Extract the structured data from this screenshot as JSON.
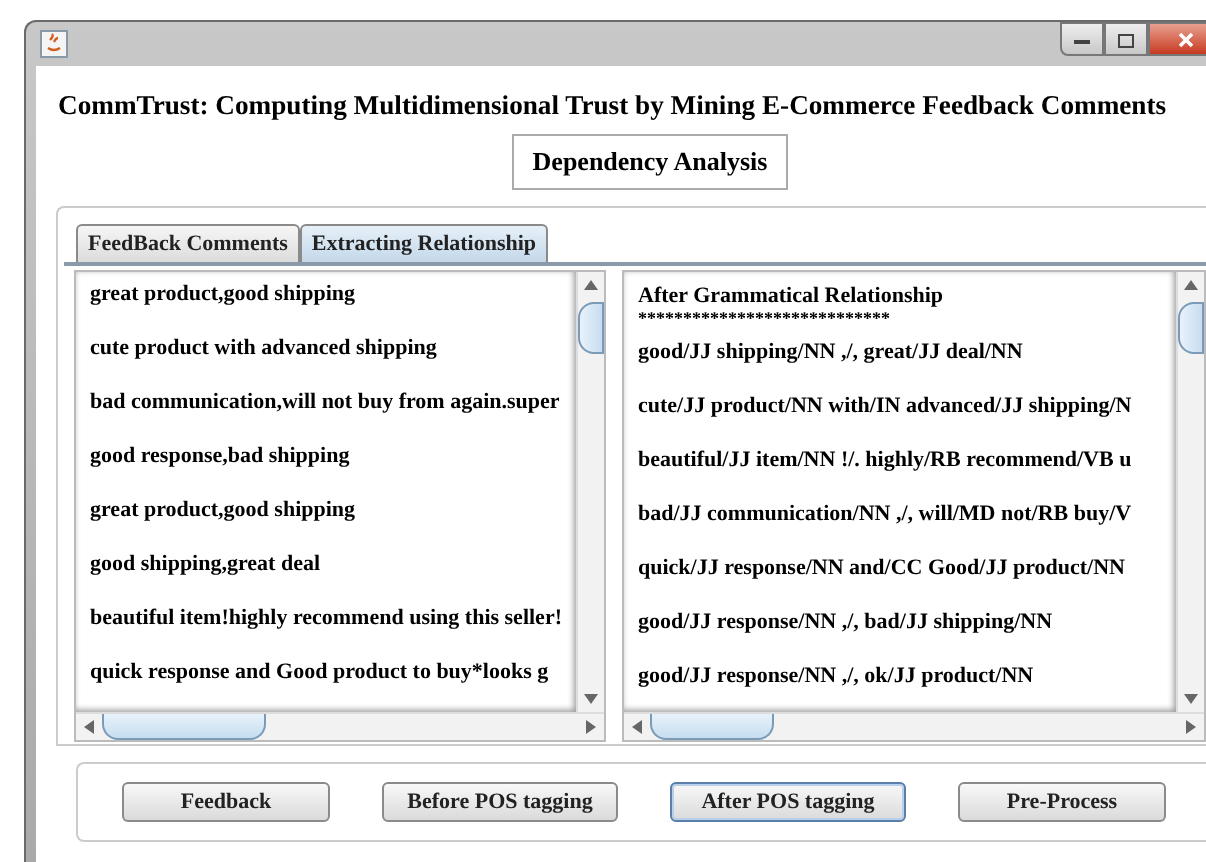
{
  "heading": "CommTrust: Computing Multidimensional Trust by Mining E-Commerce Feedback Comments",
  "section_label": "Dependency Analysis",
  "tabs": [
    {
      "label": "FeedBack Comments",
      "selected": false
    },
    {
      "label": "Extracting Relationship",
      "selected": true
    }
  ],
  "left_list": {
    "items": [
      "great product,good shipping",
      "cute product with advanced shipping",
      "bad communication,will not buy from again.super",
      "good response,bad shipping",
      "great product,good shipping",
      "good shipping,great deal",
      "beautiful item!highly recommend using this seller!",
      "quick response and Good product to buy*looks g"
    ]
  },
  "right_list": {
    "header": "After Grammatical Relationship",
    "separator": "****************************",
    "items": [
      "good/JJ shipping/NN ,/, great/JJ deal/NN",
      "cute/JJ product/NN with/IN advanced/JJ shipping/N",
      "beautiful/JJ item/NN !/. highly/RB recommend/VB u",
      "bad/JJ communication/NN ,/, will/MD not/RB buy/V",
      "quick/JJ response/NN and/CC Good/JJ product/NN",
      "good/JJ response/NN ,/, bad/JJ shipping/NN",
      "good/JJ response/NN ,/, ok/JJ product/NN"
    ]
  },
  "buttons": [
    {
      "label": "Feedback",
      "focused": false
    },
    {
      "label": "Before POS tagging",
      "focused": false
    },
    {
      "label": "After POS tagging",
      "focused": true
    },
    {
      "label": "Pre-Process",
      "focused": false
    }
  ]
}
